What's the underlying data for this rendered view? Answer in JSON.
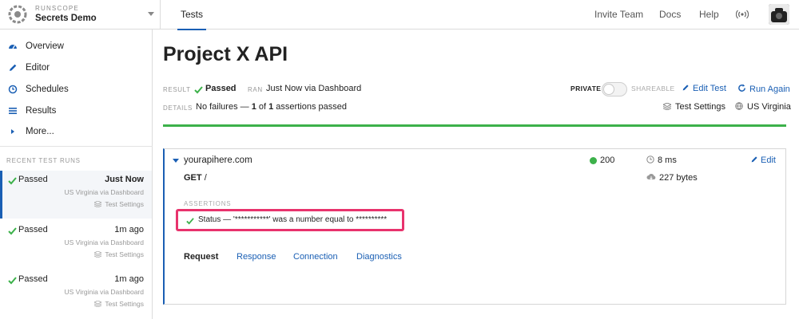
{
  "brand": {
    "kicker": "RUNSCOPE",
    "name": "Secrets Demo"
  },
  "topnav": {
    "active_tab": "Tests",
    "links": [
      "Invite Team",
      "Docs",
      "Help"
    ]
  },
  "sidebar": {
    "items": [
      {
        "label": "Overview",
        "icon": "dashboard-icon"
      },
      {
        "label": "Editor",
        "icon": "pencil-icon"
      },
      {
        "label": "Schedules",
        "icon": "clock-icon"
      },
      {
        "label": "Results",
        "icon": "list-icon"
      },
      {
        "label": "More...",
        "icon": "caret-right-icon"
      }
    ],
    "recent_heading": "RECENT TEST RUNS",
    "runs": [
      {
        "status": "Passed",
        "when": "Just Now",
        "region": "US Virginia via Dashboard",
        "settings": "Test Settings"
      },
      {
        "status": "Passed",
        "when": "1m ago",
        "region": "US Virginia via Dashboard",
        "settings": "Test Settings"
      },
      {
        "status": "Passed",
        "when": "1m ago",
        "region": "US Virginia via Dashboard",
        "settings": "Test Settings"
      }
    ]
  },
  "main": {
    "title": "Project X API",
    "result_label": "RESULT",
    "result_value": "Passed",
    "ran_label": "RAN",
    "ran_value": "Just Now via Dashboard",
    "details_label": "DETAILS",
    "details_prefix": "No failures — ",
    "details_passed": "1",
    "details_mid": " of ",
    "details_total": "1",
    "details_suffix": " assertions passed",
    "private_label": "PRIVATE",
    "shareable_label": "SHAREABLE",
    "edit_test": "Edit Test",
    "run_again": "Run Again",
    "test_settings": "Test Settings",
    "region": "US Virginia"
  },
  "request": {
    "host": "yourapihere.com",
    "method": "GET",
    "path": "/",
    "status_code": "200",
    "timing": "8 ms",
    "size": "227 bytes",
    "edit": "Edit",
    "assertions_heading": "ASSERTIONS",
    "assertion_text": "Status — '***********' was a number equal to **********",
    "tabs": [
      "Request",
      "Response",
      "Connection",
      "Diagnostics"
    ]
  },
  "colors": {
    "accent": "#1a5fb4",
    "success": "#3cb14a",
    "highlight": "#e8336d"
  }
}
